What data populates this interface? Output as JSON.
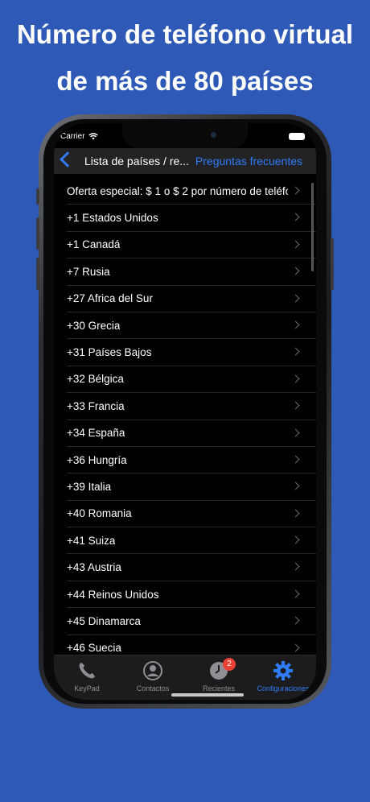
{
  "headline": {
    "line1": "Número de teléfono virtual",
    "line2": "de más de 80 países"
  },
  "status_bar": {
    "carrier": "Carrier"
  },
  "navbar": {
    "title": "Lista de países / re...",
    "right_button": "Preguntas frecuentes"
  },
  "countries": [
    {
      "label": "Oferta especial: $ 1 o $ 2 por número de teléfo..."
    },
    {
      "label": "+1 Estados Unidos"
    },
    {
      "label": "+1 Canadá"
    },
    {
      "label": "+7 Rusia"
    },
    {
      "label": "+27 Africa del Sur"
    },
    {
      "label": "+30 Grecia"
    },
    {
      "label": "+31 Países Bajos"
    },
    {
      "label": "+32 Bélgica"
    },
    {
      "label": "+33 Francia"
    },
    {
      "label": "+34 España"
    },
    {
      "label": "+36 Hungría"
    },
    {
      "label": "+39 Italia"
    },
    {
      "label": "+40 Romania"
    },
    {
      "label": "+41 Suiza"
    },
    {
      "label": "+43 Austria"
    },
    {
      "label": "+44 Reinos Unidos"
    },
    {
      "label": "+45 Dinamarca"
    },
    {
      "label": "+46 Suecia"
    }
  ],
  "tabbar": {
    "tabs": [
      {
        "label": "KeyPad",
        "icon": "phone-icon"
      },
      {
        "label": "Contactos",
        "icon": "contact-icon"
      },
      {
        "label": "Recientes",
        "icon": "clock-icon",
        "badge": "2"
      },
      {
        "label": "Configuraciones",
        "icon": "gear-icon",
        "active": true
      }
    ]
  },
  "colors": {
    "background": "#2e59b6",
    "accent": "#2f7bf5",
    "badge": "#e94235"
  }
}
